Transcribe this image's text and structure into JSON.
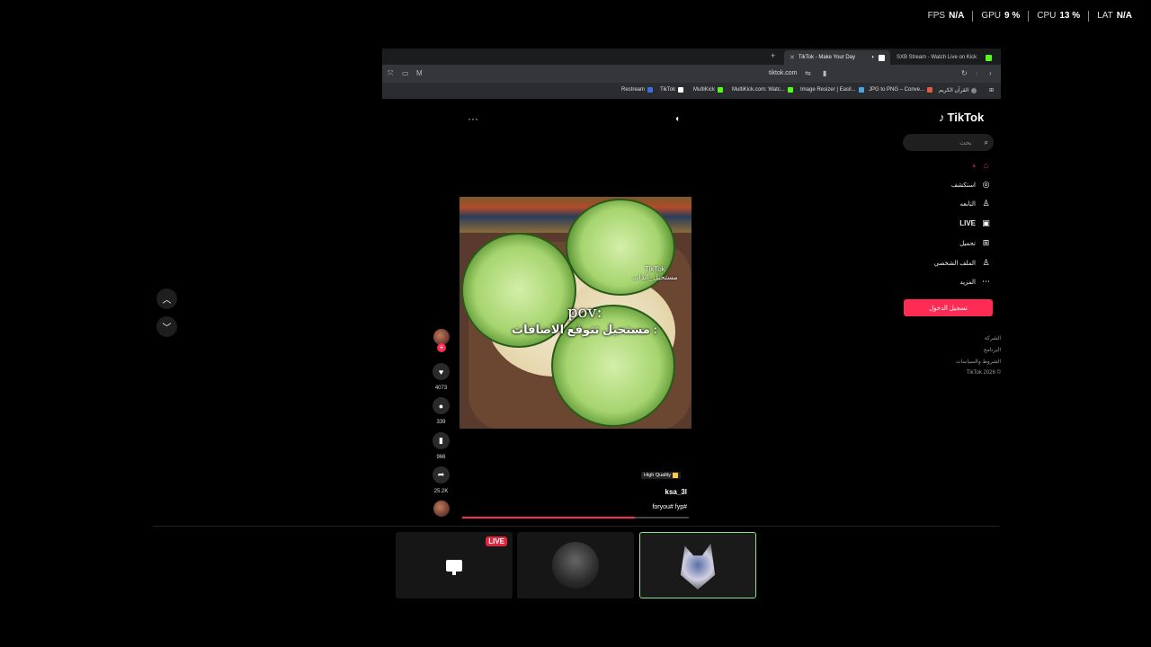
{
  "stats": {
    "fps_label": "FPS",
    "fps_value": "N/A",
    "gpu_label": "GPU",
    "gpu_value": "9 %",
    "cpu_label": "CPU",
    "cpu_value": "13 %",
    "lat_label": "LAT",
    "lat_value": "N/A"
  },
  "browser": {
    "tabs": [
      {
        "label": "TikTok - Make Your Day",
        "active": true
      },
      {
        "label": "SXB Stream - Watch Live on Kick",
        "active": false
      }
    ],
    "url": "tiktok.com",
    "bookmarks": [
      "Restream",
      "TikTok",
      "MultiKick",
      "MultiKick.com: Watc...",
      "Image Resizer | Easil...",
      "JPG to PNG – Conve...",
      "القرآن الكريم"
    ]
  },
  "tiktok": {
    "logo": "TikTok",
    "search_placeholder": "بحث",
    "nav": [
      {
        "label": "ة",
        "icon": "home-icon",
        "active": true
      },
      {
        "label": "استكشف",
        "icon": "compass-icon"
      },
      {
        "label": "التابعه",
        "icon": "user-follow-icon"
      },
      {
        "label": "LIVE",
        "icon": "live-icon"
      },
      {
        "label": "تحميل",
        "icon": "upload-icon"
      },
      {
        "label": "الملف الشخصي",
        "icon": "profile-icon"
      },
      {
        "label": "المزيد",
        "icon": "more-icon"
      }
    ],
    "login_button": "تسجيل الدخول",
    "footer": [
      "الشركة",
      "البرنامج",
      "الشروط والسياسات",
      "TikTok 2026 ©"
    ],
    "video": {
      "caption_en": "pov:",
      "caption_ar": "مستحيل تتوقع الاضافات :",
      "watermark_top": "TikTok",
      "watermark_bottom": "مستحيل_الذات",
      "likes": "4073",
      "comments": "339",
      "saves": "966",
      "shares": "25.2K",
      "quality_badge": "High Quality",
      "author": "ksa_3l",
      "hashtags": "foryou# fyp#",
      "progress": 0.76
    }
  },
  "thumbnails": [
    {
      "badge": "LIVE"
    },
    {},
    {}
  ]
}
